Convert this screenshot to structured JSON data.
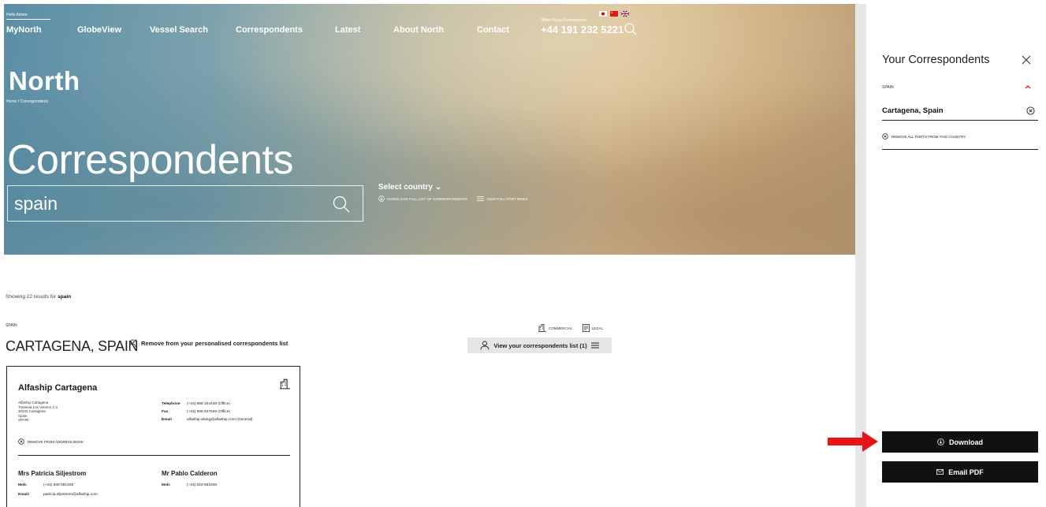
{
  "header": {
    "greeting": "Hello Aimee",
    "nav": [
      "MyNorth",
      "GlobeView",
      "Vessel Search",
      "Correspondents",
      "Latest",
      "About North",
      "Contact"
    ],
    "emergency_label": "Office Hours Emergencies",
    "phone": "+44 191 232 5221",
    "logo": "North",
    "breadcrumb": "Home / Correspondents",
    "title": "Correspondents",
    "search_value": "spain",
    "select_country": "Select country",
    "download_full_list": "DOWNLOAD FULL LIST OF CORRESPONDENTS",
    "view_port_index": "VIEW FULL PORT INDEX"
  },
  "results": {
    "showing_prefix": "Showing 22 results for ",
    "showing_query": "spain",
    "country": "SPAIN",
    "port": "CARTAGENA, SPAIN",
    "remove_personalised": "Remove from your personalised correspondents list",
    "type_commercial": "COMMERCIAL",
    "type_legal": "LEGAL",
    "view_list": "View your correspondents list (1)"
  },
  "card": {
    "name": "Alfaship Cartagena",
    "address": [
      "Alfaship Cartagena",
      "Travesía Los Vientos 1-3",
      "30202 Cartagena",
      "Spain",
      "SPAIN"
    ],
    "telephone_label": "Telephone",
    "telephone": "(+34) 868 104438 (Office)",
    "fax_label": "Fax",
    "fax": "(+34) 968 527629 (Office)",
    "email_label": "Email",
    "email": "alfaship.viking@alfaship.com (General)",
    "remove_address_book": "REMOVE FROM ADDRESS BOOK",
    "people": [
      {
        "name": "Mrs Patricia Siljestrom",
        "mob_label": "Mob:",
        "mob": "(+34) 609 081408",
        "email_label": "Email:",
        "email": "patricia.siljestrom@alfaship.com"
      },
      {
        "name": "Mr Pablo Calderon",
        "mob_label": "Mob:",
        "mob": "(+34) 619 861846"
      }
    ]
  },
  "panel": {
    "title": "Your Correspondents",
    "country": "SPAIN",
    "port": "Cartagena, Spain",
    "remove_all": "REMOVE ALL PORTS FROM THIS COUNTRY",
    "download": "Download",
    "email_pdf": "Email PDF"
  },
  "colors": {
    "accent_red": "#e8141c",
    "button_dark": "#111111"
  }
}
